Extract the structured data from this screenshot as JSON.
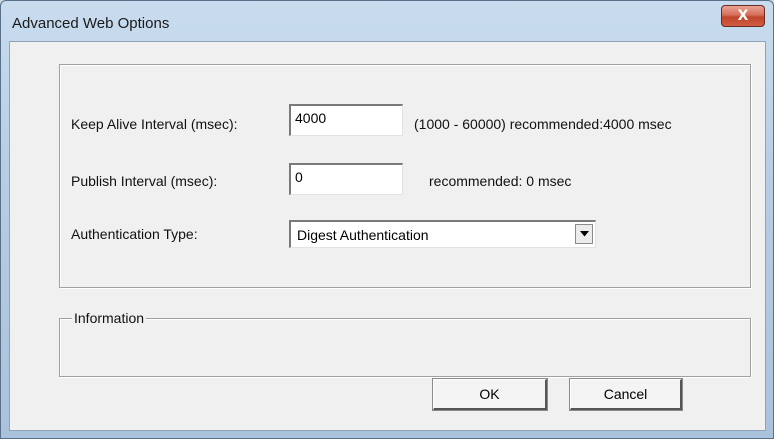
{
  "window": {
    "title": "Advanced Web Options",
    "close_glyph": "X"
  },
  "form": {
    "keep_alive": {
      "label": "Keep Alive Interval (msec):",
      "value": "4000",
      "hint": "(1000 - 60000)  recommended:4000 msec"
    },
    "publish": {
      "label": "Publish Interval (msec):",
      "value": "0",
      "hint": "recommended: 0 msec"
    },
    "auth": {
      "label": "Authentication Type:",
      "selected": "Digest Authentication"
    }
  },
  "info_group": {
    "legend": "Information"
  },
  "buttons": {
    "ok": "OK",
    "cancel": "Cancel"
  },
  "colors": {
    "close_button": "#c0452b",
    "dialog_background": "#f0f0f0"
  },
  "icons": {
    "close": "close-icon",
    "dropdown": "chevron-down-icon"
  }
}
